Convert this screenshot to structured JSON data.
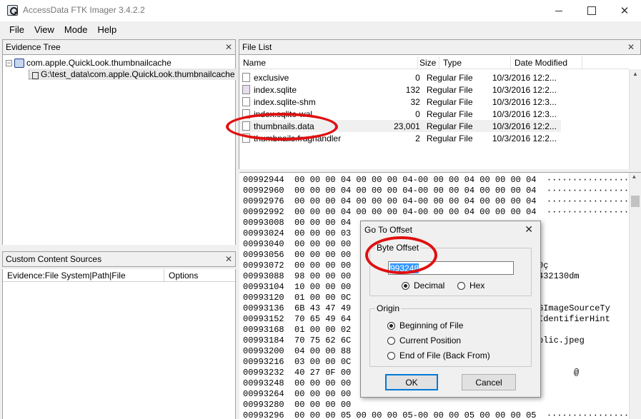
{
  "window": {
    "title": "AccessData FTK Imager 3.4.2.2"
  },
  "menu": [
    "File",
    "View",
    "Mode",
    "Help"
  ],
  "evidence_tree": {
    "title": "Evidence Tree",
    "root": "com.apple.QuickLook.thumbnailcache",
    "child": "G:\\test_data\\com.apple.QuickLook.thumbnailcache"
  },
  "custom_content": {
    "title": "Custom Content Sources",
    "col1": "Evidence:File System|Path|File",
    "col2": "Options"
  },
  "file_list": {
    "title": "File List",
    "columns": [
      "Name",
      "Size",
      "Type",
      "Date Modified"
    ],
    "rows": [
      {
        "name": "exclusive",
        "size": "0",
        "type": "Regular File",
        "date": "10/3/2016 12:2..."
      },
      {
        "name": "index.sqlite",
        "size": "132",
        "type": "Regular File",
        "date": "10/3/2016 12:2..."
      },
      {
        "name": "index.sqlite-shm",
        "size": "32",
        "type": "Regular File",
        "date": "10/3/2016 12:3..."
      },
      {
        "name": "index.sqlite-wal",
        "size": "0",
        "type": "Regular File",
        "date": "10/3/2016 12:3..."
      },
      {
        "name": "thumbnails.data",
        "size": "23,001",
        "type": "Regular File",
        "date": "10/3/2016 12:2..."
      },
      {
        "name": "thumbnails.fraghandler",
        "size": "2",
        "type": "Regular File",
        "date": "10/3/2016 12:2..."
      }
    ]
  },
  "hex_rows": [
    {
      "offset": "00992944",
      "hex": "00 00 00 04 00 00 00 04-00 00 00 04 00 00 00 04",
      "ascii": "················"
    },
    {
      "offset": "00992960",
      "hex": "00 00 00 04 00 00 00 04-00 00 00 04 00 00 00 04",
      "ascii": "················"
    },
    {
      "offset": "00992976",
      "hex": "00 00 00 04 00 00 00 04-00 00 00 04 00 00 00 04",
      "ascii": "················"
    },
    {
      "offset": "00992992",
      "hex": "00 00 00 04 00 00 00 04-00 00 00 04 00 00 00 04",
      "ascii": "················"
    },
    {
      "offset": "00993008",
      "hex": "00 00 00 04",
      "ascii": ""
    },
    {
      "offset": "00993024",
      "hex": "00 00 00 03",
      "ascii": ""
    },
    {
      "offset": "00993040",
      "hex": "00 00 00 00",
      "ascii": ""
    },
    {
      "offset": "00993056",
      "hex": "00 00 00 00",
      "ascii": ""
    },
    {
      "offset": "00993072",
      "hex": "00 00 00 00",
      "ascii": "0ç"
    },
    {
      "offset": "00993088",
      "hex": "98 00 00 00",
      "ascii": "432130dm"
    },
    {
      "offset": "00993104",
      "hex": "10 00 00 00",
      "ascii": ""
    },
    {
      "offset": "00993120",
      "hex": "01 00 00 0C",
      "ascii": ""
    },
    {
      "offset": "00993136",
      "hex": "6B 43 47 49",
      "ascii": "GImageSourceTy"
    },
    {
      "offset": "00993152",
      "hex": "70 65 49 64",
      "ascii": "IdentifierHint"
    },
    {
      "offset": "00993168",
      "hex": "01 00 00 02",
      "ascii": ""
    },
    {
      "offset": "00993184",
      "hex": "70 75 62 6C",
      "ascii": "blic.jpeg"
    },
    {
      "offset": "00993200",
      "hex": "04 00 00 88",
      "ascii": ""
    },
    {
      "offset": "00993216",
      "hex": "03 00 00 0C",
      "ascii": ""
    },
    {
      "offset": "00993232",
      "hex": "40 27 0F 00",
      "ascii": "@"
    },
    {
      "offset": "00993248",
      "hex": "00 00 00 00",
      "ascii": ""
    },
    {
      "offset": "00993264",
      "hex": "00 00 00 00",
      "ascii": ""
    },
    {
      "offset": "00993280",
      "hex": "00 00 00 00",
      "ascii": ""
    },
    {
      "offset": "00993296",
      "hex": "00 00 00 05 00 00 00 05-00 00 00 05 00 00 00 05",
      "ascii": "················"
    }
  ],
  "dialog": {
    "title": "Go To Offset",
    "byte_offset_label": "Byte Offset",
    "offset_value": "993248",
    "format_options": [
      "Decimal",
      "Hex"
    ],
    "format_selected": "Decimal",
    "origin_label": "Origin",
    "origin_options": [
      "Beginning of File",
      "Current Position",
      "End of File (Back From)"
    ],
    "origin_selected": "Beginning of File",
    "ok_label": "OK",
    "cancel_label": "Cancel"
  },
  "colors": {
    "annotation": "#e01010",
    "selection": "#3399ff"
  }
}
